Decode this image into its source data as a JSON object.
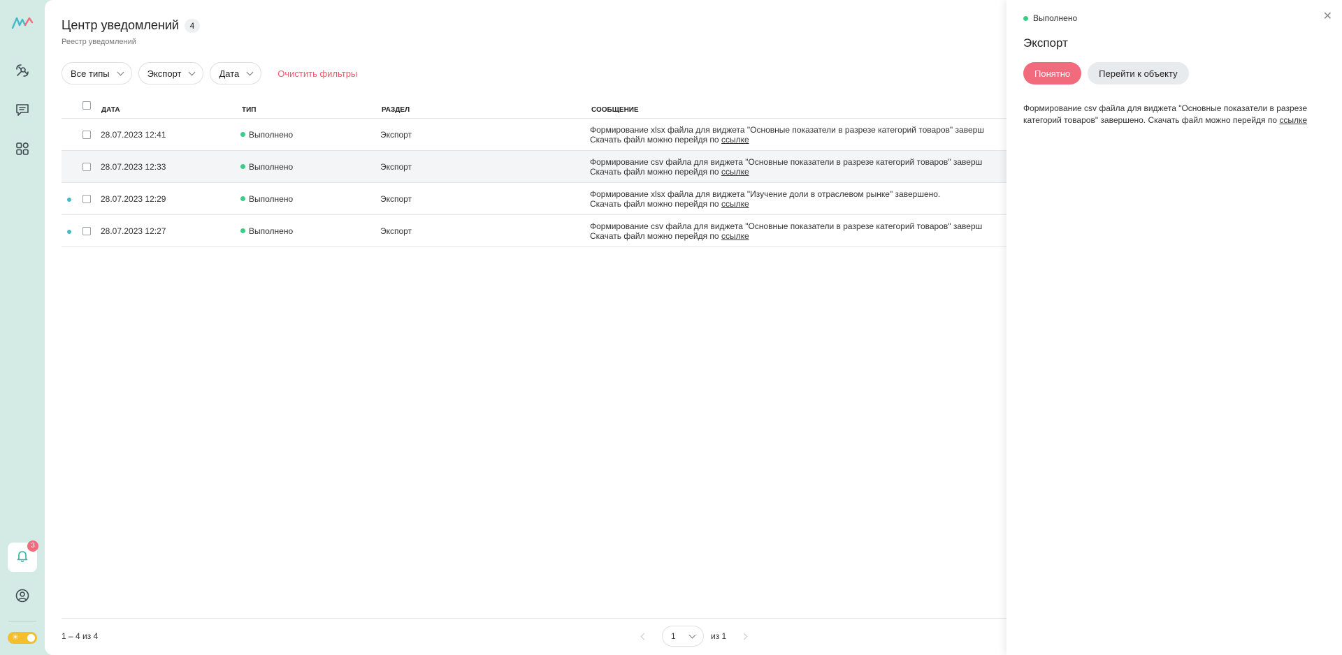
{
  "sidebar": {
    "logo_icon": "brand-logo-icon",
    "nav": [
      {
        "icon": "satellite-icon"
      },
      {
        "icon": "chat-icon"
      },
      {
        "icon": "apps-grid-icon"
      }
    ],
    "notifications_badge": "3",
    "bell_icon": "bell-icon",
    "profile_icon": "user-circle-icon",
    "theme_toggle_icon": "sun-icon"
  },
  "header": {
    "title": "Центр уведомлений",
    "count": "4",
    "subtitle": "Реестр уведомлений"
  },
  "filters": {
    "type": "Все типы",
    "section": "Экспорт",
    "date": "Дата",
    "clear": "Очистить фильтры"
  },
  "table": {
    "columns": {
      "date": "ДАТА",
      "type": "ТИП",
      "section": "РАЗДЕЛ",
      "message": "СООБЩЕНИЕ"
    },
    "rows": [
      {
        "date": "28.07.2023 12:41",
        "status": "Выполнено",
        "section": "Экспорт",
        "line1": "Формирование xlsx файла для виджета \"Основные показатели в разрезе категорий товаров\" заверш",
        "line2": "Скачать файл можно перейдя по ",
        "link": "ссылке",
        "unread": false
      },
      {
        "date": "28.07.2023 12:33",
        "status": "Выполнено",
        "section": "Экспорт",
        "line1": "Формирование csv файла для виджета \"Основные показатели в разрезе категорий товаров\" заверш",
        "line2": "Скачать файл можно перейдя по ",
        "link": "ссылке",
        "unread": false
      },
      {
        "date": "28.07.2023 12:29",
        "status": "Выполнено",
        "section": "Экспорт",
        "line1": "Формирование xlsx файла для виджета \"Изучение доли в отраслевом рынке\" завершено.",
        "line2": "Скачать файл можно перейдя по ",
        "link": "ссылке",
        "unread": true
      },
      {
        "date": "28.07.2023 12:27",
        "status": "Выполнено",
        "section": "Экспорт",
        "line1": "Формирование csv файла для виджета \"Основные показатели в разрезе категорий товаров\" заверш",
        "line2": "Скачать файл можно перейдя по ",
        "link": "ссылке",
        "unread": true
      }
    ]
  },
  "footer": {
    "range": "1 – 4 из 4",
    "page": "1",
    "of": "из 1"
  },
  "drawer": {
    "status": "Выполнено",
    "title": "Экспорт",
    "primary": "Понятно",
    "secondary": "Перейти к объекту",
    "body": "Формирование csv файла для виджета \"Основные показатели в разрезе категорий товаров\" завершено. Скачать файл можно перейдя по ",
    "link": "ссылке",
    "close_icon": "close-icon"
  },
  "colors": {
    "accent": "#f26b7d",
    "sidebar_bg": "#d3ebe4",
    "status_ok": "#3ccc8a",
    "unread": "#45b9c8"
  }
}
